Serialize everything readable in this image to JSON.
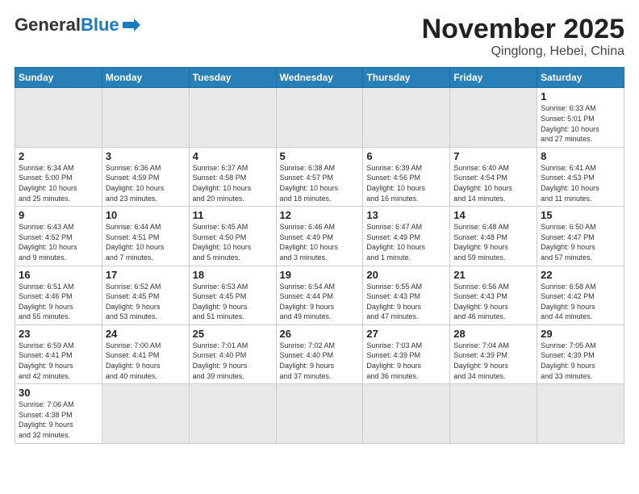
{
  "header": {
    "logo_general": "General",
    "logo_blue": "Blue",
    "month": "November 2025",
    "location": "Qinglong, Hebei, China"
  },
  "weekdays": [
    "Sunday",
    "Monday",
    "Tuesday",
    "Wednesday",
    "Thursday",
    "Friday",
    "Saturday"
  ],
  "weeks": [
    [
      {
        "day": "",
        "info": ""
      },
      {
        "day": "",
        "info": ""
      },
      {
        "day": "",
        "info": ""
      },
      {
        "day": "",
        "info": ""
      },
      {
        "day": "",
        "info": ""
      },
      {
        "day": "",
        "info": ""
      },
      {
        "day": "1",
        "info": "Sunrise: 6:33 AM\nSunset: 5:01 PM\nDaylight: 10 hours\nand 27 minutes."
      }
    ],
    [
      {
        "day": "2",
        "info": "Sunrise: 6:34 AM\nSunset: 5:00 PM\nDaylight: 10 hours\nand 25 minutes."
      },
      {
        "day": "3",
        "info": "Sunrise: 6:36 AM\nSunset: 4:59 PM\nDaylight: 10 hours\nand 23 minutes."
      },
      {
        "day": "4",
        "info": "Sunrise: 6:37 AM\nSunset: 4:58 PM\nDaylight: 10 hours\nand 20 minutes."
      },
      {
        "day": "5",
        "info": "Sunrise: 6:38 AM\nSunset: 4:57 PM\nDaylight: 10 hours\nand 18 minutes."
      },
      {
        "day": "6",
        "info": "Sunrise: 6:39 AM\nSunset: 4:56 PM\nDaylight: 10 hours\nand 16 minutes."
      },
      {
        "day": "7",
        "info": "Sunrise: 6:40 AM\nSunset: 4:54 PM\nDaylight: 10 hours\nand 14 minutes."
      },
      {
        "day": "8",
        "info": "Sunrise: 6:41 AM\nSunset: 4:53 PM\nDaylight: 10 hours\nand 11 minutes."
      }
    ],
    [
      {
        "day": "9",
        "info": "Sunrise: 6:43 AM\nSunset: 4:52 PM\nDaylight: 10 hours\nand 9 minutes."
      },
      {
        "day": "10",
        "info": "Sunrise: 6:44 AM\nSunset: 4:51 PM\nDaylight: 10 hours\nand 7 minutes."
      },
      {
        "day": "11",
        "info": "Sunrise: 6:45 AM\nSunset: 4:50 PM\nDaylight: 10 hours\nand 5 minutes."
      },
      {
        "day": "12",
        "info": "Sunrise: 6:46 AM\nSunset: 4:49 PM\nDaylight: 10 hours\nand 3 minutes."
      },
      {
        "day": "13",
        "info": "Sunrise: 6:47 AM\nSunset: 4:49 PM\nDaylight: 10 hours\nand 1 minute."
      },
      {
        "day": "14",
        "info": "Sunrise: 6:48 AM\nSunset: 4:48 PM\nDaylight: 9 hours\nand 59 minutes."
      },
      {
        "day": "15",
        "info": "Sunrise: 6:50 AM\nSunset: 4:47 PM\nDaylight: 9 hours\nand 57 minutes."
      }
    ],
    [
      {
        "day": "16",
        "info": "Sunrise: 6:51 AM\nSunset: 4:46 PM\nDaylight: 9 hours\nand 55 minutes."
      },
      {
        "day": "17",
        "info": "Sunrise: 6:52 AM\nSunset: 4:45 PM\nDaylight: 9 hours\nand 53 minutes."
      },
      {
        "day": "18",
        "info": "Sunrise: 6:53 AM\nSunset: 4:45 PM\nDaylight: 9 hours\nand 51 minutes."
      },
      {
        "day": "19",
        "info": "Sunrise: 6:54 AM\nSunset: 4:44 PM\nDaylight: 9 hours\nand 49 minutes."
      },
      {
        "day": "20",
        "info": "Sunrise: 6:55 AM\nSunset: 4:43 PM\nDaylight: 9 hours\nand 47 minutes."
      },
      {
        "day": "21",
        "info": "Sunrise: 6:56 AM\nSunset: 4:43 PM\nDaylight: 9 hours\nand 46 minutes."
      },
      {
        "day": "22",
        "info": "Sunrise: 6:58 AM\nSunset: 4:42 PM\nDaylight: 9 hours\nand 44 minutes."
      }
    ],
    [
      {
        "day": "23",
        "info": "Sunrise: 6:59 AM\nSunset: 4:41 PM\nDaylight: 9 hours\nand 42 minutes."
      },
      {
        "day": "24",
        "info": "Sunrise: 7:00 AM\nSunset: 4:41 PM\nDaylight: 9 hours\nand 40 minutes."
      },
      {
        "day": "25",
        "info": "Sunrise: 7:01 AM\nSunset: 4:40 PM\nDaylight: 9 hours\nand 39 minutes."
      },
      {
        "day": "26",
        "info": "Sunrise: 7:02 AM\nSunset: 4:40 PM\nDaylight: 9 hours\nand 37 minutes."
      },
      {
        "day": "27",
        "info": "Sunrise: 7:03 AM\nSunset: 4:39 PM\nDaylight: 9 hours\nand 36 minutes."
      },
      {
        "day": "28",
        "info": "Sunrise: 7:04 AM\nSunset: 4:39 PM\nDaylight: 9 hours\nand 34 minutes."
      },
      {
        "day": "29",
        "info": "Sunrise: 7:05 AM\nSunset: 4:39 PM\nDaylight: 9 hours\nand 33 minutes."
      }
    ],
    [
      {
        "day": "30",
        "info": "Sunrise: 7:06 AM\nSunset: 4:38 PM\nDaylight: 9 hours\nand 32 minutes."
      },
      {
        "day": "",
        "info": ""
      },
      {
        "day": "",
        "info": ""
      },
      {
        "day": "",
        "info": ""
      },
      {
        "day": "",
        "info": ""
      },
      {
        "day": "",
        "info": ""
      },
      {
        "day": "",
        "info": ""
      }
    ]
  ]
}
